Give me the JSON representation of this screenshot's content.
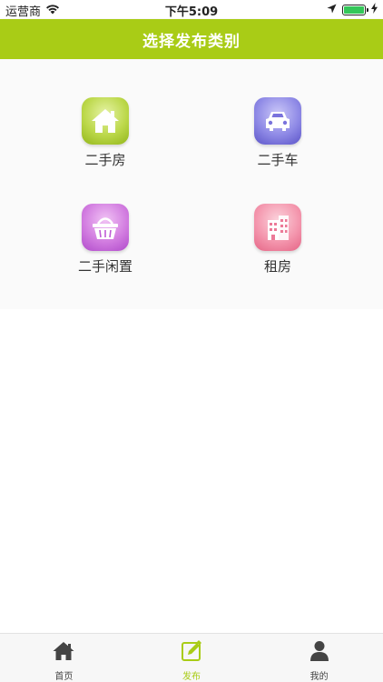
{
  "status_bar": {
    "carrier": "运营商",
    "time": "下午5:09"
  },
  "nav": {
    "title": "选择发布类别"
  },
  "categories": [
    {
      "label": "二手房",
      "icon": "house-icon",
      "color": "#a9cc16"
    },
    {
      "label": "二手车",
      "icon": "car-icon",
      "color": "#6b64d6"
    },
    {
      "label": "二手闲置",
      "icon": "basket-icon",
      "color": "#c05bd6"
    },
    {
      "label": "租房",
      "icon": "building-icon",
      "color": "#ec7a98"
    }
  ],
  "tabs": [
    {
      "label": "首页",
      "icon": "home-icon",
      "active": false
    },
    {
      "label": "发布",
      "icon": "edit-icon",
      "active": true
    },
    {
      "label": "我的",
      "icon": "user-icon",
      "active": false
    }
  ],
  "colors": {
    "accent": "#a9cc16",
    "inactive_tab": "#444444"
  }
}
